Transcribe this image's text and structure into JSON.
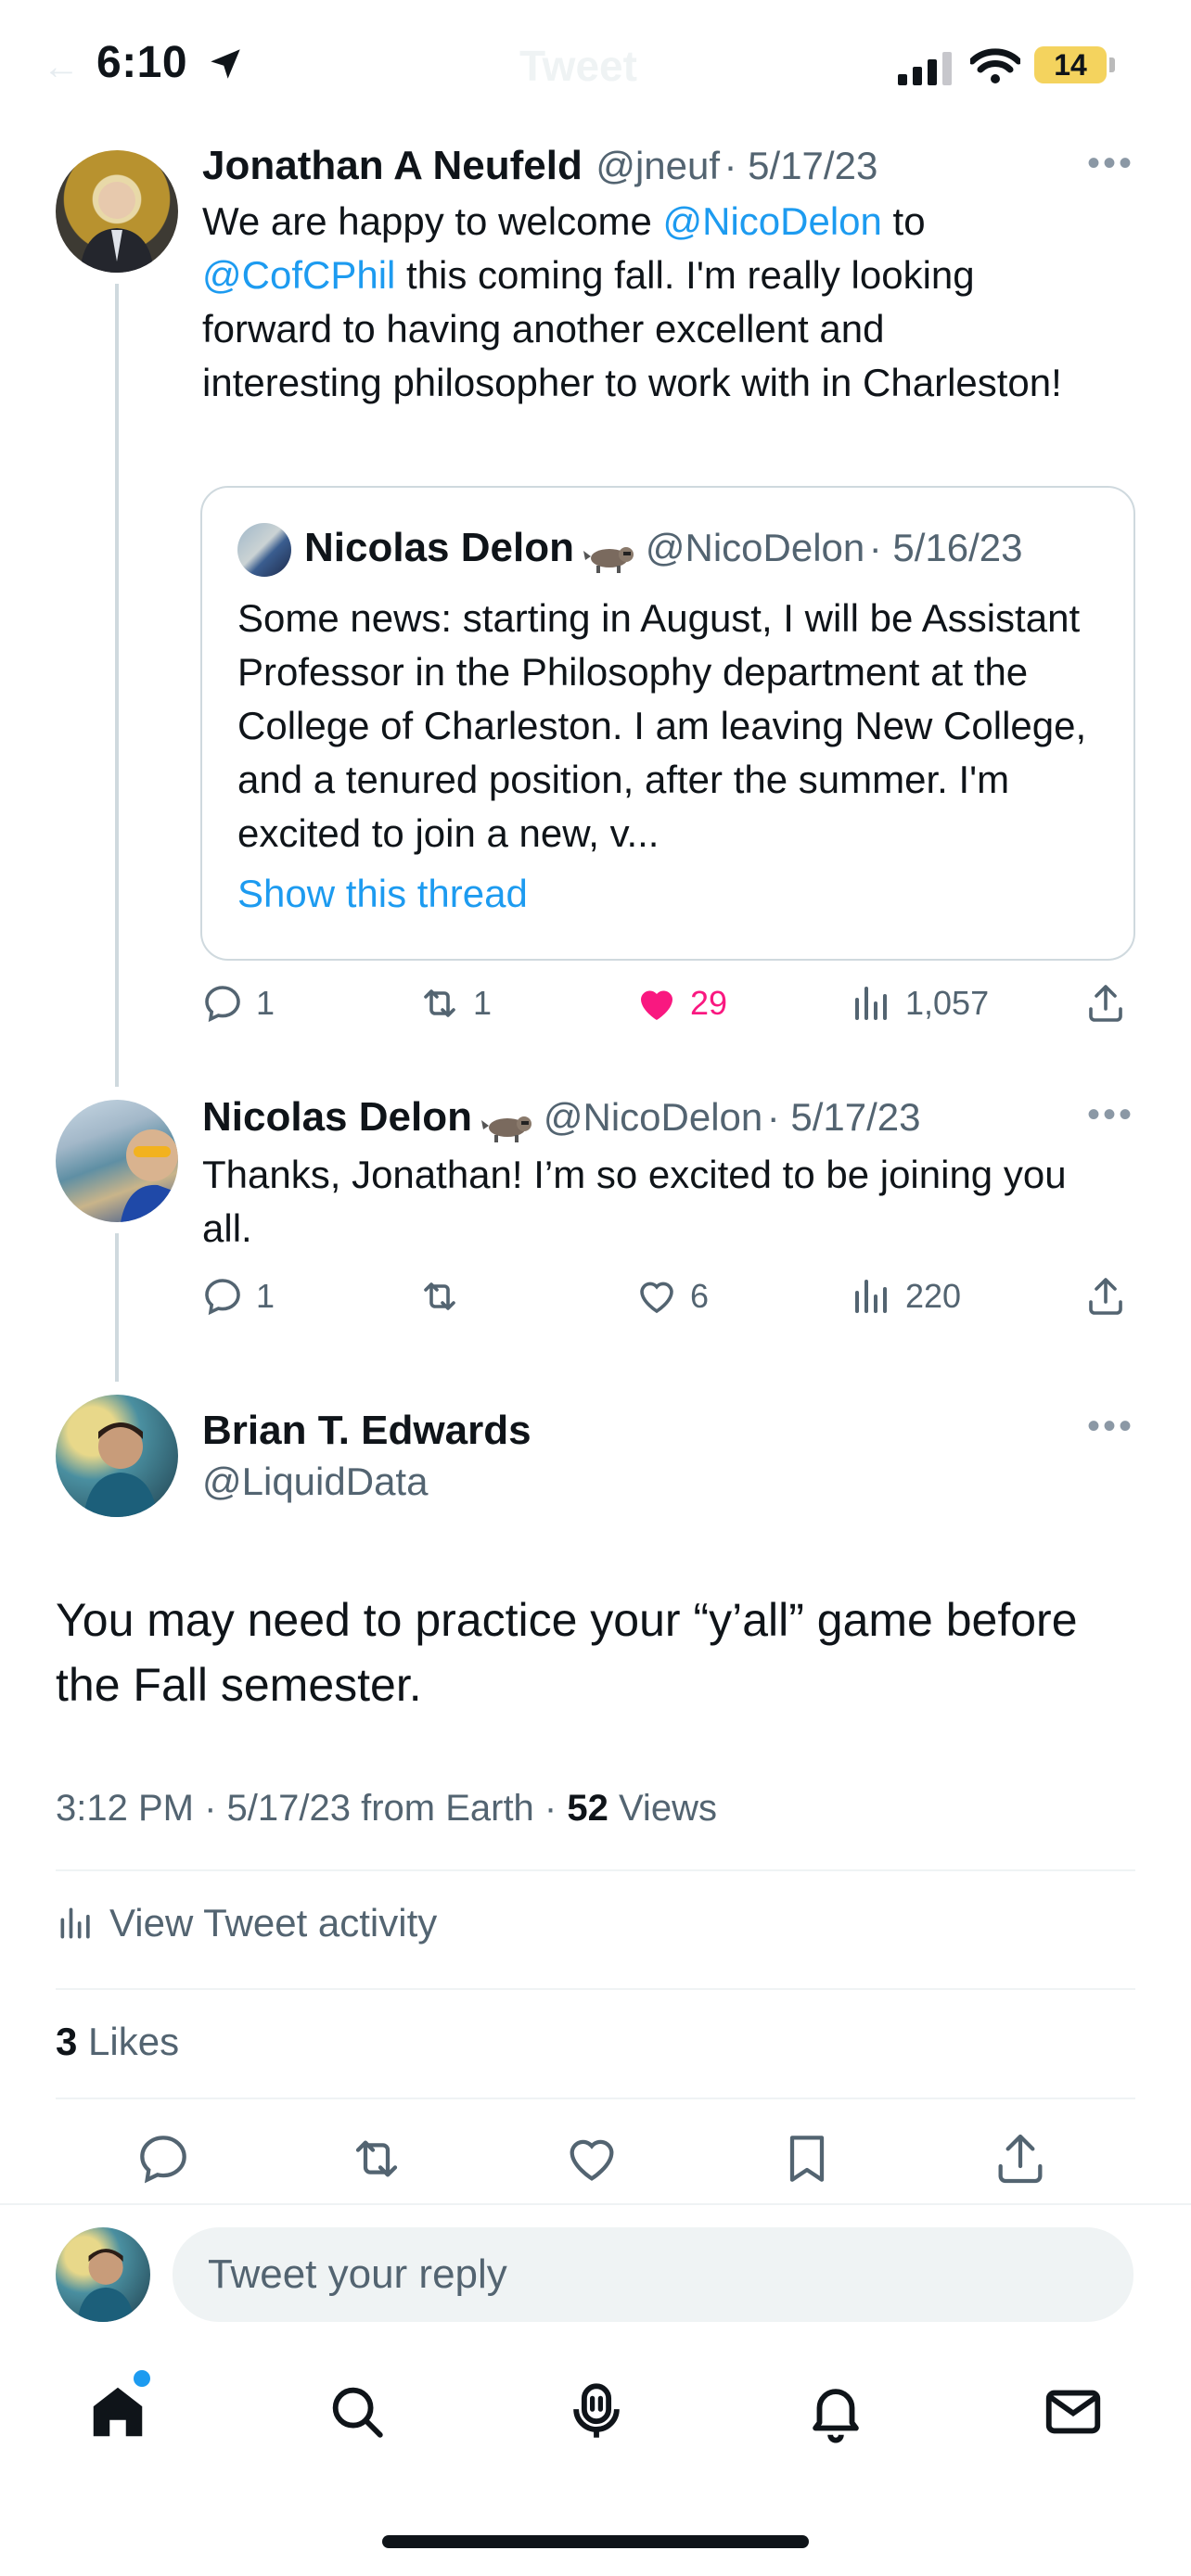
{
  "status_bar": {
    "time": "6:10",
    "title": "Tweet",
    "battery": "14"
  },
  "tweet1": {
    "name": "Jonathan A Neufeld",
    "handle": "@jneuf",
    "date": "· 5/17/23",
    "text_parts": [
      "We are happy to welcome ",
      "@NicoDelon",
      " to",
      "@CofCPhil",
      " this coming fall. I'm really looking forward to having another excellent and interesting philosopher to work with in Charleston!"
    ],
    "quote": {
      "name": "Nicolas Delon",
      "handle": "@NicoDelon",
      "date": "· 5/16/23",
      "text": "Some news: starting in August, I will be Assistant Professor in the Philosophy department at the College of Charleston. I am leaving New College, and a tenured position, after the summer. I'm excited to join a new, v...",
      "show_thread": "Show this thread"
    },
    "replies": "1",
    "retweets": "1",
    "likes": "29",
    "views": "1,057"
  },
  "tweet2": {
    "name": "Nicolas Delon",
    "handle": "@NicoDelon",
    "date": "· 5/17/23",
    "text": "Thanks, Jonathan! I’m so excited to be joining you all.",
    "replies": "1",
    "likes": "6",
    "views": "220"
  },
  "main_tweet": {
    "name": "Brian T. Edwards",
    "handle": "@LiquidData",
    "text": "You may need to practice your “y’all” game before the Fall semester.",
    "meta_time": "3:12 PM · 5/17/23 from Earth · ",
    "meta_views_count": "52",
    "meta_views_label": " Views",
    "activity": "View Tweet activity",
    "likes_count": "3",
    "likes_label": " Likes"
  },
  "reply": {
    "placeholder": "Tweet your reply"
  },
  "colors": {
    "accent": "#1d9bf0",
    "like": "#f91880",
    "muted": "#536471"
  }
}
